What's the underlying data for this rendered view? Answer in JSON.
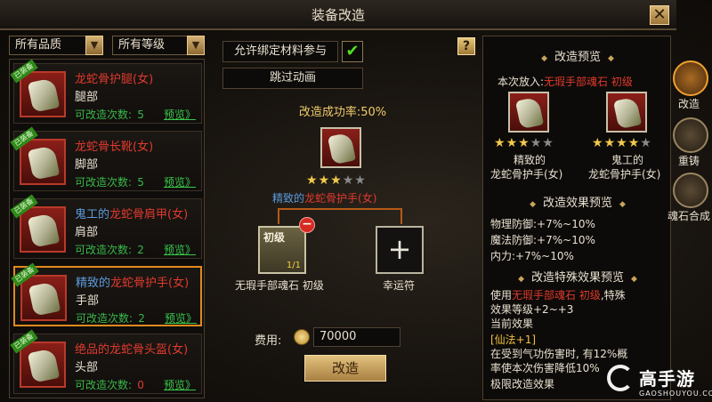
{
  "window": {
    "title": "装备改造",
    "close": "✕"
  },
  "filters": {
    "quality": "所有品质",
    "level": "所有等级",
    "arrow": "▼"
  },
  "items": [
    {
      "badge": "已装备",
      "prefix": "",
      "name": "龙蛇骨护腿(女)",
      "part": "腿部",
      "count_label": "可改造次数:",
      "count": "5",
      "preview": "预览》"
    },
    {
      "badge": "已装备",
      "prefix": "",
      "name": "龙蛇骨长靴(女)",
      "part": "脚部",
      "count_label": "可改造次数:",
      "count": "5",
      "preview": "预览》"
    },
    {
      "badge": "已装备",
      "prefix": "鬼工的",
      "name": "龙蛇骨肩甲(女)",
      "part": "肩部",
      "count_label": "可改造次数:",
      "count": "2",
      "preview": "预览》"
    },
    {
      "badge": "已装备",
      "prefix": "精致的",
      "name": "龙蛇骨护手(女)",
      "part": "手部",
      "count_label": "可改造次数:",
      "count": "2",
      "preview": "预览》"
    },
    {
      "badge": "已装备",
      "prefix": "绝品的",
      "name": "龙蛇骨头盔(女)",
      "part": "头部",
      "count_label": "可改造次数:",
      "count": "0",
      "preview": "预览》"
    }
  ],
  "center": {
    "allow_bound": "允许绑定材料参与",
    "check": "✔",
    "skip_anim": "跳过动画",
    "success_rate": "改造成功率:50%",
    "target_prefix": "精致的",
    "target_name": "龙蛇骨护手(女)",
    "target_stars": 3,
    "max_stars": 5,
    "stone_level": "初级",
    "stone_count": "1/1",
    "stone_caption": "无瑕手部魂石 初级",
    "remove": "−",
    "lucky_plus": "+",
    "lucky_caption": "幸运符",
    "cost_label": "费用:",
    "cost_value": "70000",
    "forge_button": "改造"
  },
  "help": "?",
  "right": {
    "preview_title": "改造预览",
    "placed_prefix": "本次放入:",
    "placed_item": "无瑕手部魂石 初级",
    "before": {
      "stars": 3,
      "prefix": "精致的",
      "name": "龙蛇骨护手(女)"
    },
    "after": {
      "stars": 4,
      "prefix": "鬼工的",
      "name": "龙蛇骨护手(女)"
    },
    "effect_title": "改造效果预览",
    "effects": [
      "物理防御:+7%~10%",
      "魔法防御:+7%~10%",
      "内力:+7%~10%"
    ],
    "special_title": "改造特殊效果预览",
    "special_line1_a": "使用",
    "special_line1_item": "无瑕手部魂石 初级",
    "special_line1_b": ",特殊",
    "special_line2": "效果等级+2~+3",
    "current_effect": "当前效果",
    "skill": "[仙法+1]",
    "skill_desc1": "在受到气功伤害时, 有12%概",
    "skill_desc2": "率使本次伤害降低10%",
    "limit_effect": "极限改造效果"
  },
  "tabs": [
    {
      "label": "改造",
      "active": true
    },
    {
      "label": "重铸",
      "active": false
    },
    {
      "label": "魂石合成",
      "active": false
    }
  ],
  "watermark": {
    "text": "高手游",
    "sub": "GAOSHOUYOU.COM"
  },
  "colors": {
    "name_red": "#e03a2e",
    "prefix_blue": "#5b9bdc",
    "green": "#39b84a",
    "gold": "#f0cc6c",
    "selected_border": "#e08a1e"
  }
}
